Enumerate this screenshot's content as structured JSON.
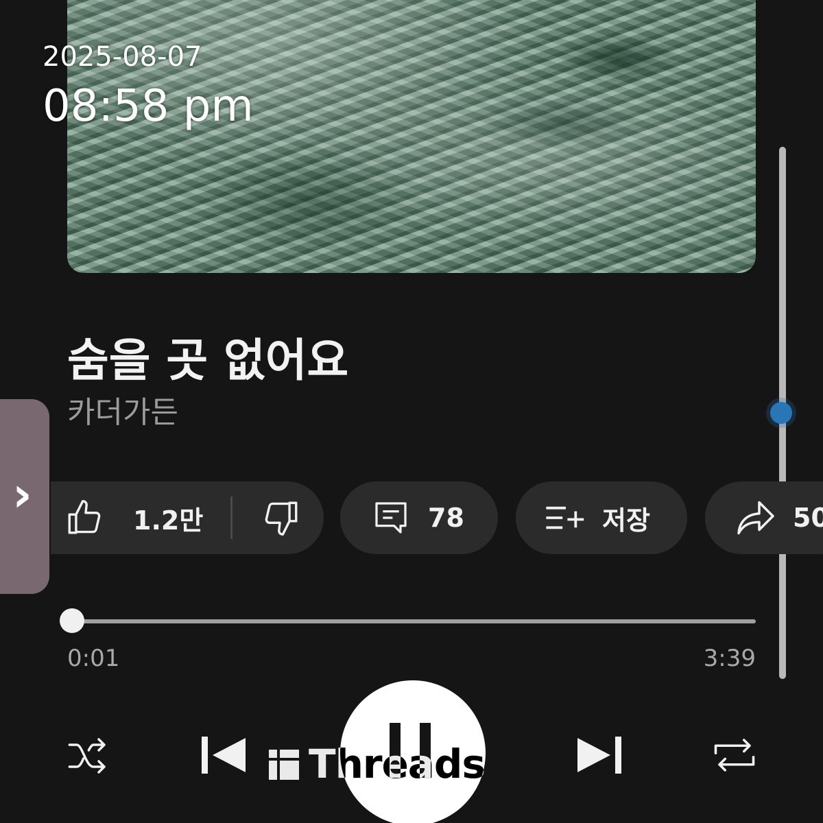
{
  "overlay": {
    "date": "2025-08-07",
    "time": "08:58 pm"
  },
  "song": {
    "title": "숨을 곳 없어요",
    "artist": "카더가든"
  },
  "actions": {
    "likes": "1.2만",
    "comments": "78",
    "save_label": "저장",
    "share_count": "50"
  },
  "playback": {
    "current_time": "0:01",
    "total_time": "3:39",
    "progress_fraction": 0.005,
    "state": "playing"
  },
  "watermark": {
    "text": "Threads"
  },
  "colors": {
    "background": "#151515",
    "pill": "#2b2b2b",
    "scroll_thumb": "#2a75b5",
    "side_handle": "#7a6870"
  },
  "icons": [
    "thumbs-up-icon",
    "thumbs-down-icon",
    "comment-icon",
    "add-to-playlist-icon",
    "share-icon",
    "shuffle-icon",
    "previous-icon",
    "pause-icon",
    "next-icon",
    "repeat-icon",
    "chevron-right-icon",
    "threads-logo-icon"
  ]
}
